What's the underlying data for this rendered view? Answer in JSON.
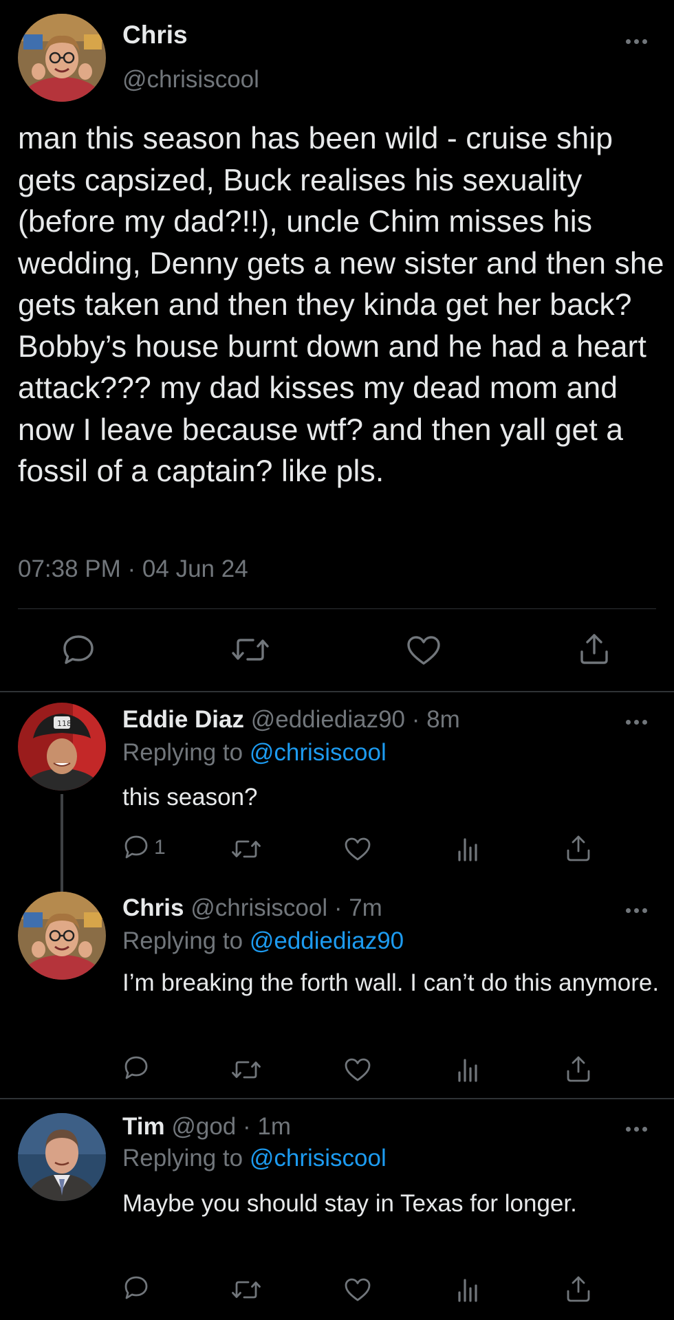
{
  "main_tweet": {
    "name": "Chris",
    "handle": "@chrisiscool",
    "text": "man this season has been wild - cruise ship gets capsized, Buck realises his sexuality (before my dad?!!), uncle Chim misses his wedding, Denny gets a new sister and then she gets taken and then they kinda get her back? Bobby’s house burnt down and he had a heart attack??? my dad kisses my dead mom and now I leave because wtf? and then yall get a fossil of a captain? like pls.",
    "timestamp": "07:38 PM · 04 Jun 24",
    "icons": {
      "more": "more-horizontal-icon",
      "reply": "reply-icon",
      "retweet": "retweet-icon",
      "like": "heart-icon",
      "share": "share-icon"
    }
  },
  "replies": [
    {
      "name": "Eddie Diaz",
      "handle_time": "@eddiediaz90 · 8m",
      "replying_label": "Replying to ",
      "replying_to": "@chrisiscool",
      "text": "this season?",
      "reply_count": "1",
      "icons": [
        "reply-icon",
        "retweet-icon",
        "heart-icon",
        "analytics-icon",
        "share-icon"
      ]
    },
    {
      "name": "Chris",
      "handle_time": "@chrisiscool · 7m",
      "replying_label": "Replying to ",
      "replying_to": "@eddiediaz90",
      "text": "I’m breaking the forth wall. I can’t do this anymore.",
      "reply_count": "",
      "icons": [
        "reply-icon",
        "retweet-icon",
        "heart-icon",
        "analytics-icon",
        "share-icon"
      ]
    },
    {
      "name": "Tim",
      "handle_time": "@god · 1m",
      "replying_label": "Replying to ",
      "replying_to": "@chrisiscool",
      "text": "Maybe you should stay in Texas for longer.",
      "reply_count": "",
      "icons": [
        "reply-icon",
        "retweet-icon",
        "heart-icon",
        "analytics-icon",
        "share-icon"
      ]
    }
  ],
  "colors": {
    "background": "#000000",
    "text_primary": "#E7E9EA",
    "text_secondary": "#71767B",
    "link": "#1D9BF0",
    "divider": "#2F3336"
  }
}
